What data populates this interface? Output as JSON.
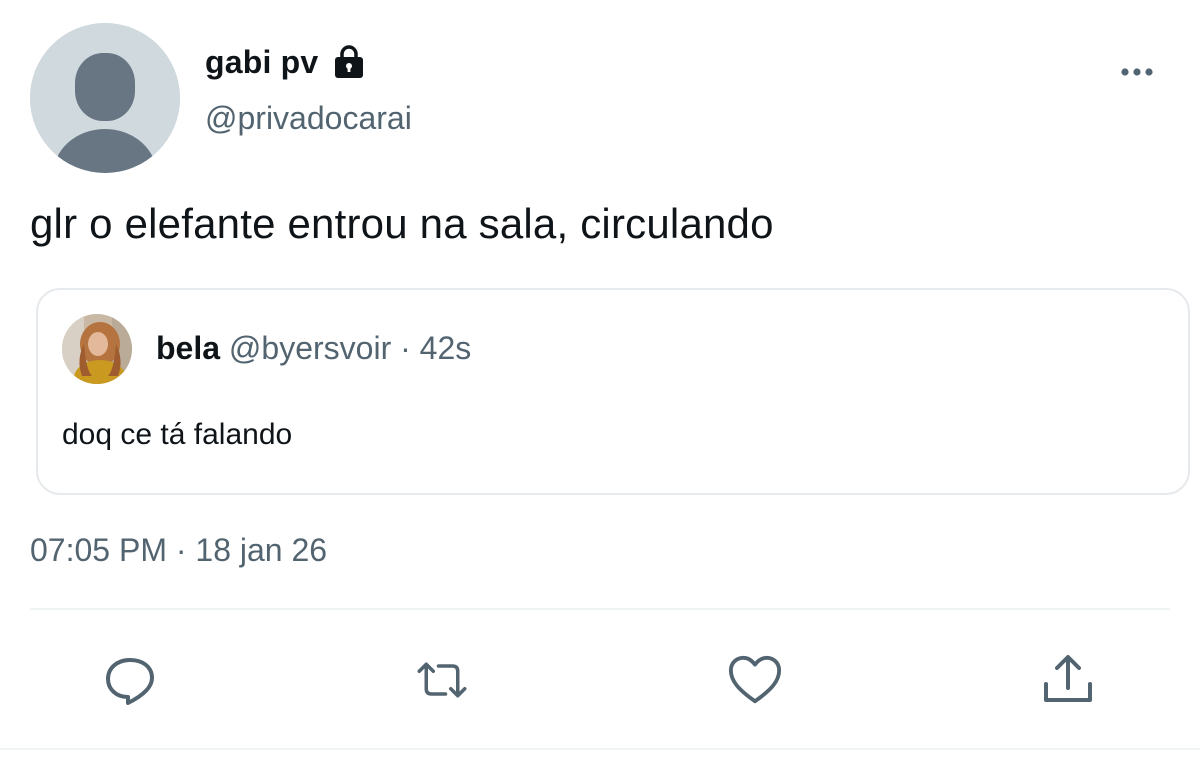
{
  "author": {
    "display_name": "gabi pv",
    "handle": "@privadocarai",
    "protected_icon": "lock-icon",
    "avatar_icon": "default-avatar-icon"
  },
  "tweet": {
    "text": "glr o elefante entrou na sala, circulando",
    "timestamp": "07:05 PM · 18 jan 26"
  },
  "quoted_tweet": {
    "display_name": "bela",
    "handle": "@byersvoir",
    "separator": "·",
    "time": "42s",
    "text": "doq ce tá falando"
  },
  "actions": [
    {
      "name": "reply",
      "icon": "reply-icon"
    },
    {
      "name": "retweet",
      "icon": "retweet-icon"
    },
    {
      "name": "like",
      "icon": "heart-icon"
    },
    {
      "name": "share",
      "icon": "share-icon"
    }
  ],
  "colors": {
    "primary_text": "#0f1419",
    "secondary_text": "#536471",
    "border": "#e7eaed",
    "avatar_bg": "#cfd9de",
    "avatar_fg": "#687684"
  }
}
